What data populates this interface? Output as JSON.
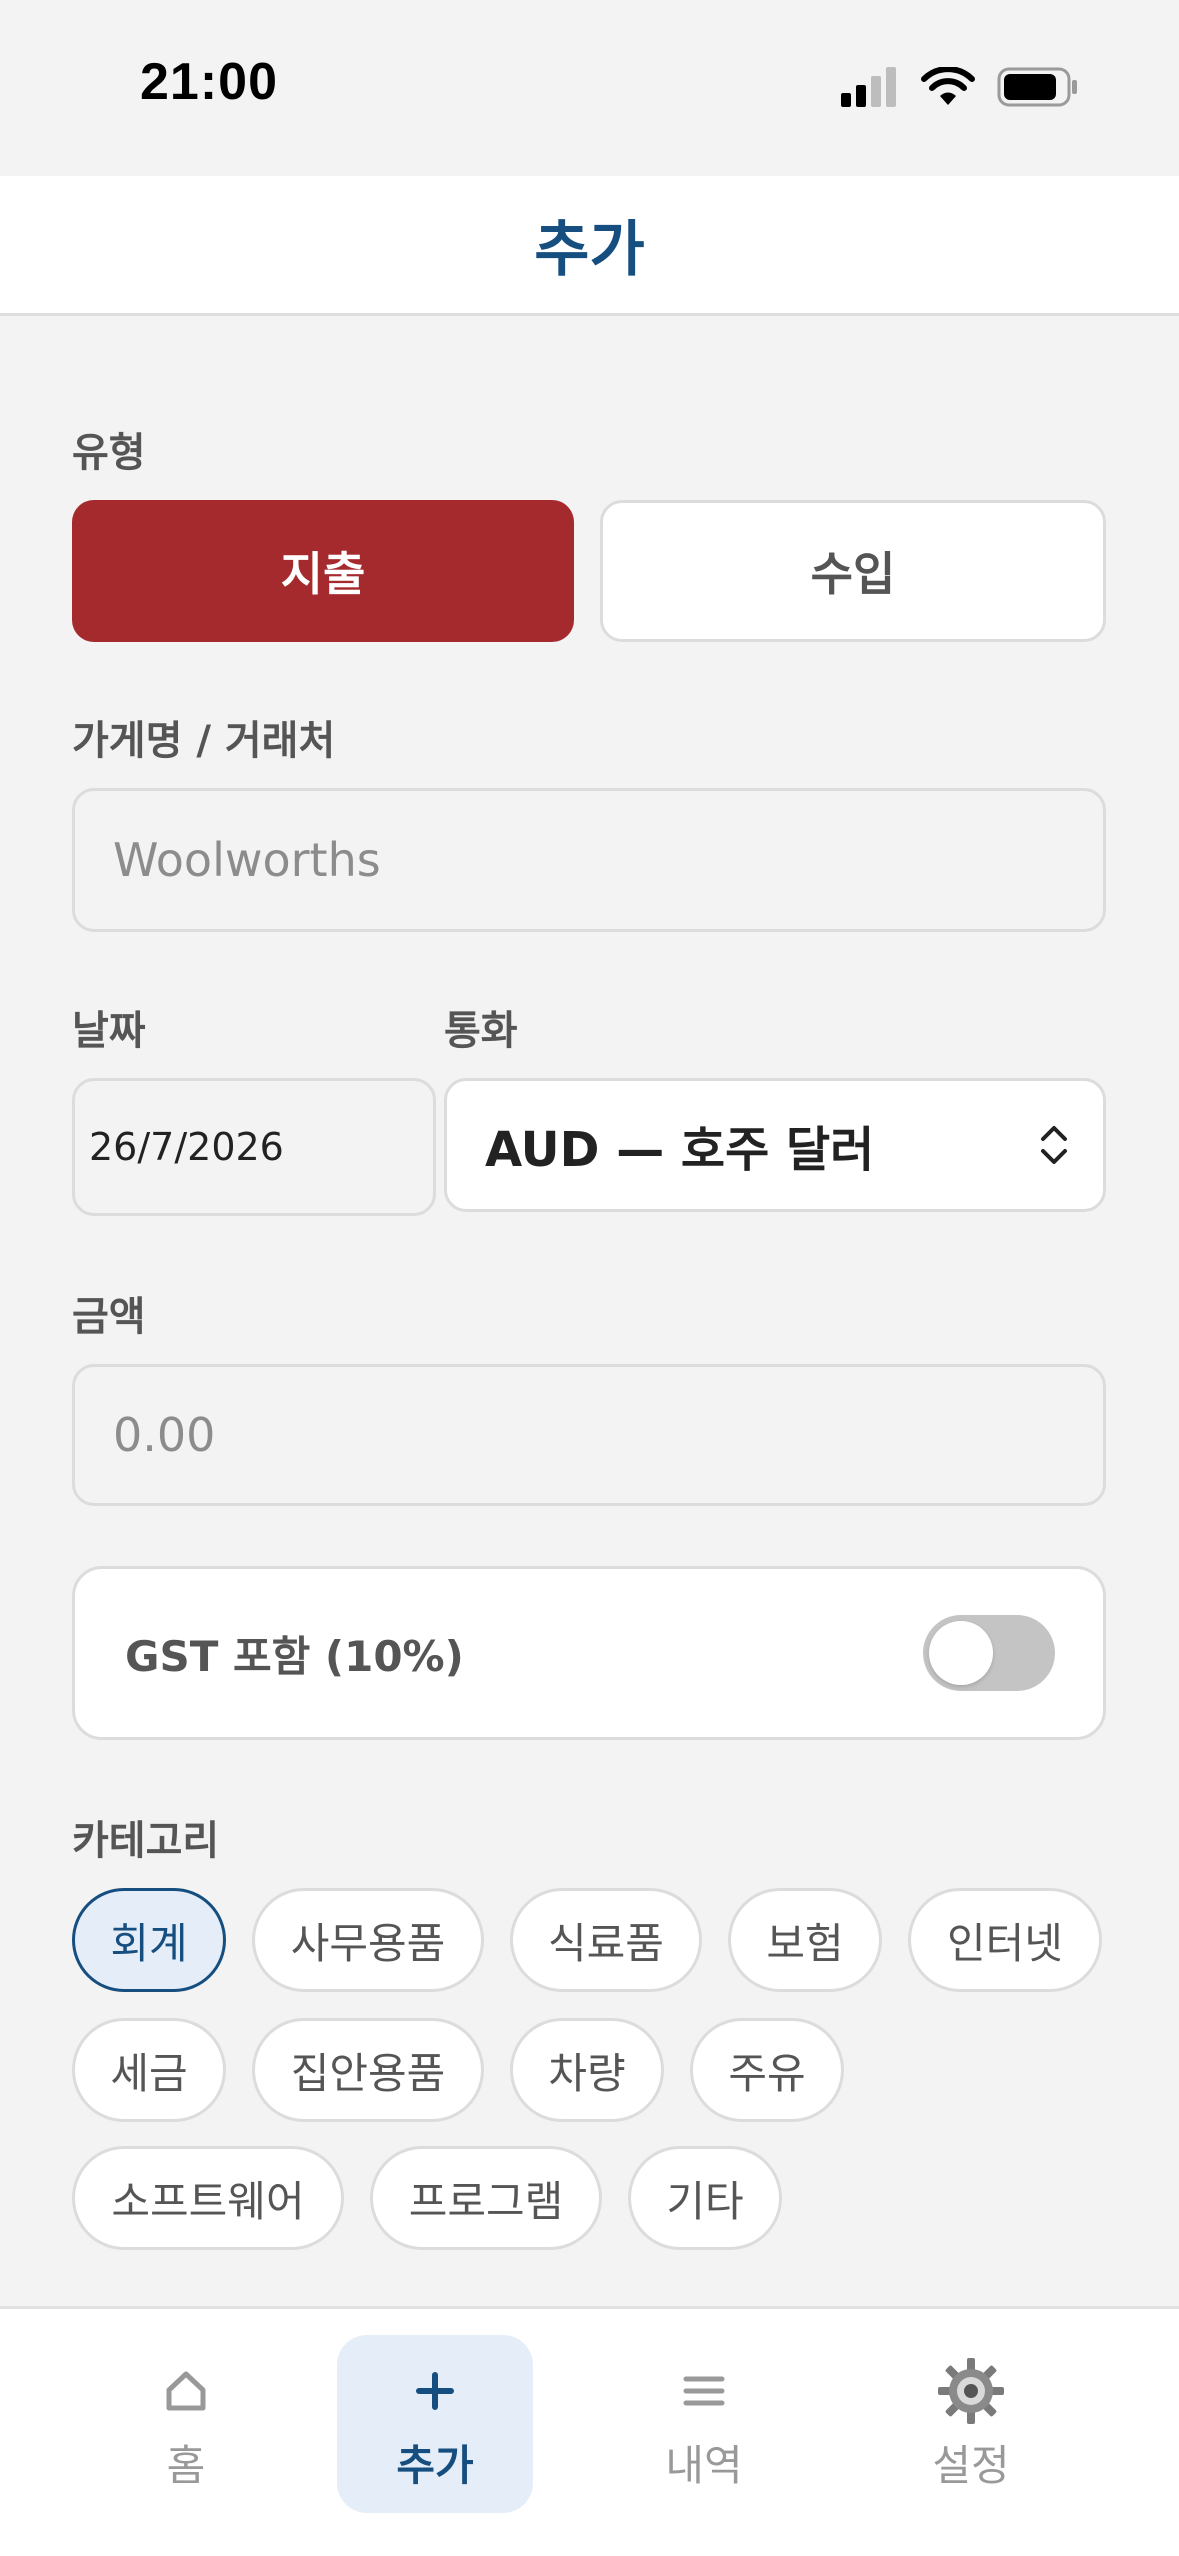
{
  "status_bar": {
    "time": "21:00"
  },
  "header": {
    "title": "추가"
  },
  "form": {
    "type_label": "유형",
    "type_options": {
      "expense": "지출",
      "income": "수입"
    },
    "merchant_label": "가게명 / 거래처",
    "merchant_placeholder": "Woolworths",
    "date_label": "날짜",
    "date_value": "26/7/2026",
    "currency_label": "통화",
    "currency_value": "AUD — 호주 달러",
    "amount_label": "금액",
    "amount_placeholder": "0.00",
    "gst_label": "GST 포함 (10%)",
    "gst_enabled": false,
    "category_label": "카테고리",
    "categories": [
      "회계",
      "사무용품",
      "식료품",
      "보험",
      "인터넷",
      "세금",
      "집안용품",
      "차량",
      "주유",
      "소프트웨어",
      "프로그램",
      "기타"
    ],
    "selected_category": "회계"
  },
  "nav": {
    "items": [
      {
        "label": "홈",
        "icon": "home-icon"
      },
      {
        "label": "추가",
        "icon": "plus-icon"
      },
      {
        "label": "내역",
        "icon": "list-icon"
      },
      {
        "label": "설정",
        "icon": "gear-icon"
      }
    ],
    "active": "추가"
  },
  "colors": {
    "accent": "#174e80",
    "expense": "#a52a2d",
    "background": "#f3f3f3"
  }
}
